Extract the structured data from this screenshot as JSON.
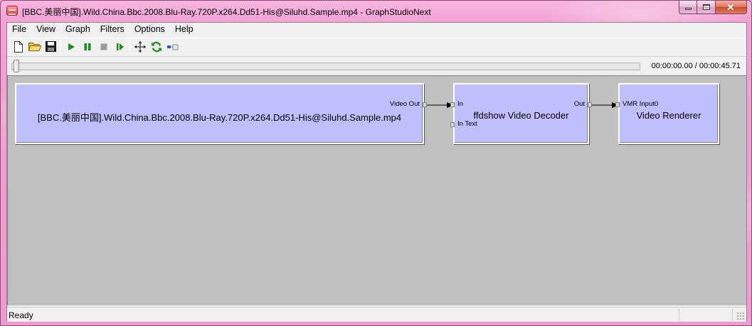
{
  "window": {
    "title": "[BBC.美丽中国].Wild.China.Bbc.2008.Blu-Ray.720P.x264.Dd51-His@Siluhd.Sample.mp4 - GraphStudioNext",
    "icon": "graphstudionext-app-icon",
    "close_glyph": "✕"
  },
  "menu": [
    "File",
    "View",
    "Graph",
    "Filters",
    "Options",
    "Help"
  ],
  "toolbar": {
    "buttons": [
      {
        "name": "new-graph",
        "icon": "new-document-icon"
      },
      {
        "name": "open-graph",
        "icon": "open-folder-icon"
      },
      {
        "name": "save-graph",
        "icon": "save-disk-icon"
      },
      {
        "name": "play",
        "icon": "play-icon",
        "color": "#1a8f1a"
      },
      {
        "name": "pause",
        "icon": "pause-icon",
        "color": "#1a8f1a"
      },
      {
        "name": "stop",
        "icon": "stop-icon",
        "color": "#9a9a9a"
      },
      {
        "name": "step-frame",
        "icon": "frame-step-icon",
        "color": "#1a8f1a"
      },
      {
        "name": "arrange",
        "icon": "arrange-icon"
      },
      {
        "name": "refresh",
        "icon": "refresh-icon",
        "color": "#1a8f1a"
      },
      {
        "name": "seek-mode",
        "icon": "seekbar-toggle-icon"
      }
    ]
  },
  "seek": {
    "position_fraction": 0.0,
    "time_text": "00:00:00.00 / 00:00:45.71"
  },
  "graph": {
    "filters": [
      {
        "id": "source",
        "name": "[BBC.美丽中国].Wild.China.Bbc.2008.Blu-Ray.720P.x264.Dd51-His@Siluhd.Sample.mp4",
        "pins_out": [
          "Video Out"
        ],
        "pins_in": []
      },
      {
        "id": "decoder",
        "name": "ffdshow Video Decoder",
        "pins_in": [
          "In",
          "In Text"
        ],
        "pins_out": [
          "Out"
        ]
      },
      {
        "id": "renderer",
        "name": "Video Renderer",
        "pins_in": [
          "VMR Input0"
        ],
        "pins_out": []
      }
    ],
    "connections": [
      {
        "from": "source.Video Out",
        "to": "decoder.In"
      },
      {
        "from": "decoder.Out",
        "to": "renderer.VMR Input0"
      }
    ]
  },
  "status": {
    "text": "Ready"
  },
  "colors": {
    "filter_fill": "#bfbffd",
    "canvas_bg": "#c0c0c0",
    "frame": "#f0a2d4"
  }
}
